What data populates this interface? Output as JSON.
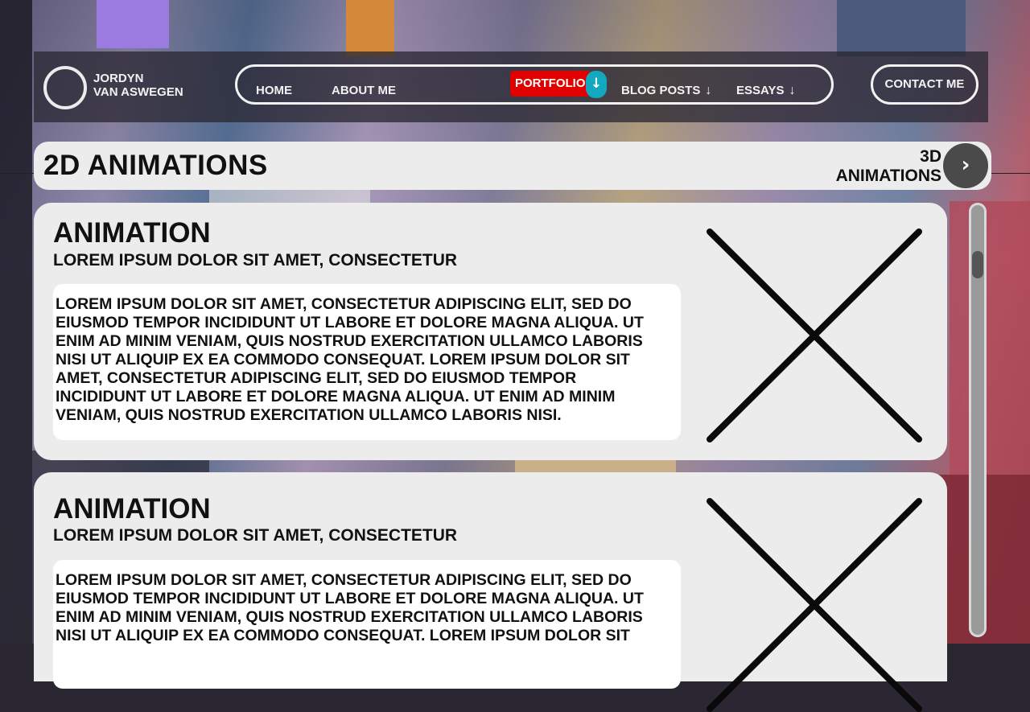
{
  "brand": {
    "name_line1": "JORDYN",
    "name_line2": "VAN ASWEGEN"
  },
  "nav": {
    "home": "HOME",
    "about": "ABOUT ME",
    "portfolio": "PORTFOLIO",
    "portfolio_arrow": "↓",
    "blog": "BLOG POSTS",
    "blog_arrow": "↓",
    "essays": "ESSAYS",
    "essays_arrow": "↓",
    "contact": "CONTACT ME"
  },
  "section": {
    "title": "2D ANIMATIONS",
    "next_line1": "3D",
    "next_line2": "ANIMATIONS",
    "next_icon": "›"
  },
  "cards": [
    {
      "title": "ANIMATION",
      "subtitle": "LOREM IPSUM DOLOR SIT AMET, CONSECTETUR",
      "body": "LOREM IPSUM DOLOR SIT AMET, CONSECTETUR ADIPISCING ELIT, SED DO EIUSMOD TEMPOR INCIDIDUNT UT LABORE ET DOLORE MAGNA ALIQUA. UT ENIM AD MINIM VENIAM, QUIS NOSTRUD EXERCITATION ULLAMCO LABORIS NISI UT ALIQUIP EX EA COMMODO CONSEQUAT. LOREM IPSUM DOLOR SIT AMET, CONSECTETUR ADIPISCING ELIT, SED DO EIUSMOD TEMPOR INCIDIDUNT UT LABORE ET DOLORE MAGNA ALIQUA. UT ENIM AD MINIM VENIAM, QUIS NOSTRUD EXERCITATION ULLAMCO LABORIS NISI."
    },
    {
      "title": "ANIMATION",
      "subtitle": "LOREM IPSUM DOLOR SIT AMET, CONSECTETUR",
      "body": "LOREM IPSUM DOLOR SIT AMET, CONSECTETUR ADIPISCING ELIT, SED DO EIUSMOD TEMPOR INCIDIDUNT UT LABORE ET DOLORE MAGNA ALIQUA. UT ENIM AD MINIM VENIAM, QUIS NOSTRUD EXERCITATION ULLAMCO LABORIS NISI UT ALIQUIP EX EA COMMODO CONSEQUAT. LOREM IPSUM DOLOR SIT"
    }
  ],
  "icons": {
    "placeholder": "image-placeholder-icon",
    "next": "chevron-right-icon",
    "arrow": "arrow-down-icon"
  },
  "colors": {
    "portfolio_active": "#e00000",
    "portfolio_arrow": "#14a8c0",
    "card_bg": "#ececec",
    "text": "#111111"
  }
}
